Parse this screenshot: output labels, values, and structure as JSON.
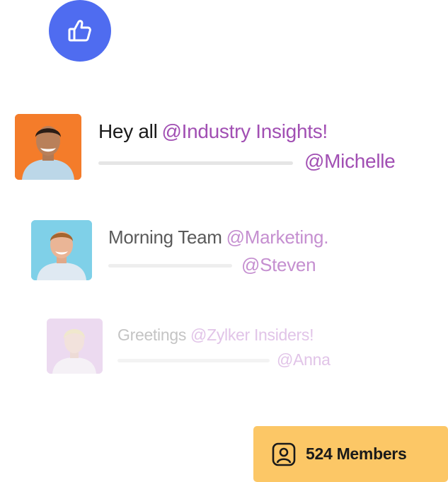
{
  "like_badge": {
    "icon": "thumbs-up-icon",
    "color": "#4f6cf0"
  },
  "posts": [
    {
      "greeting": "Hey all",
      "mention": "@Industry Insights!",
      "author": "@Michelle",
      "avatar_bg": "#f47c2a"
    },
    {
      "greeting": "Morning Team",
      "mention": "@Marketing.",
      "author": "@Steven",
      "avatar_bg": "#7fd0e8"
    },
    {
      "greeting": "Greetings",
      "mention": "@Zylker Insiders!",
      "author": "@Anna",
      "avatar_bg": "#ead6ef"
    }
  ],
  "members": {
    "icon": "user-profile-icon",
    "label": "524 Members",
    "color": "#fcc766"
  }
}
